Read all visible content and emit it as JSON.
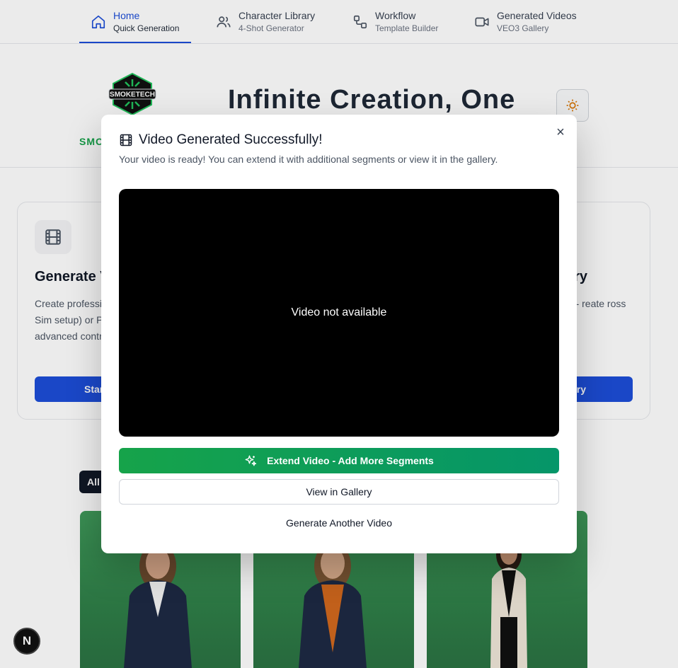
{
  "nav": {
    "items": [
      {
        "title": "Home",
        "subtitle": "Quick Generation",
        "icon": "home-icon",
        "active": true
      },
      {
        "title": "Character Library",
        "subtitle": "4-Shot Generator",
        "icon": "users-icon",
        "active": false
      },
      {
        "title": "Workflow",
        "subtitle": "Template Builder",
        "icon": "workflow-icon",
        "active": false
      },
      {
        "title": "Generated Videos",
        "subtitle": "VEO3 Gallery",
        "icon": "video-camera-icon",
        "active": false
      }
    ]
  },
  "hero": {
    "logo_text": "SMOKETECH",
    "brand_partial": "SMO",
    "title": "Infinite Creation, One"
  },
  "card": {
    "left_title": "Generate V",
    "left_text": "Create professi videos with Sim setup) or Power advanced contr",
    "left_button": "Star",
    "right_title": "ry",
    "right_text": "ur ultra- reate ross all your",
    "right_button": "ry"
  },
  "filters": {
    "active_label": "All"
  },
  "modal": {
    "title": "Video Generated Successfully!",
    "description": "Your video is ready! You can extend it with additional segments or view it in the gallery.",
    "video_message": "Video not available",
    "extend_label": "Extend Video - Add More Segments",
    "gallery_label": "View in Gallery",
    "another_label": "Generate Another Video",
    "close_glyph": "×"
  },
  "badge": {
    "letter": "N"
  },
  "colors": {
    "primary": "#1d4ed8",
    "success": "#16a34a",
    "video_bg": "#000000",
    "thumbnail_green": "#3f9a5a"
  }
}
